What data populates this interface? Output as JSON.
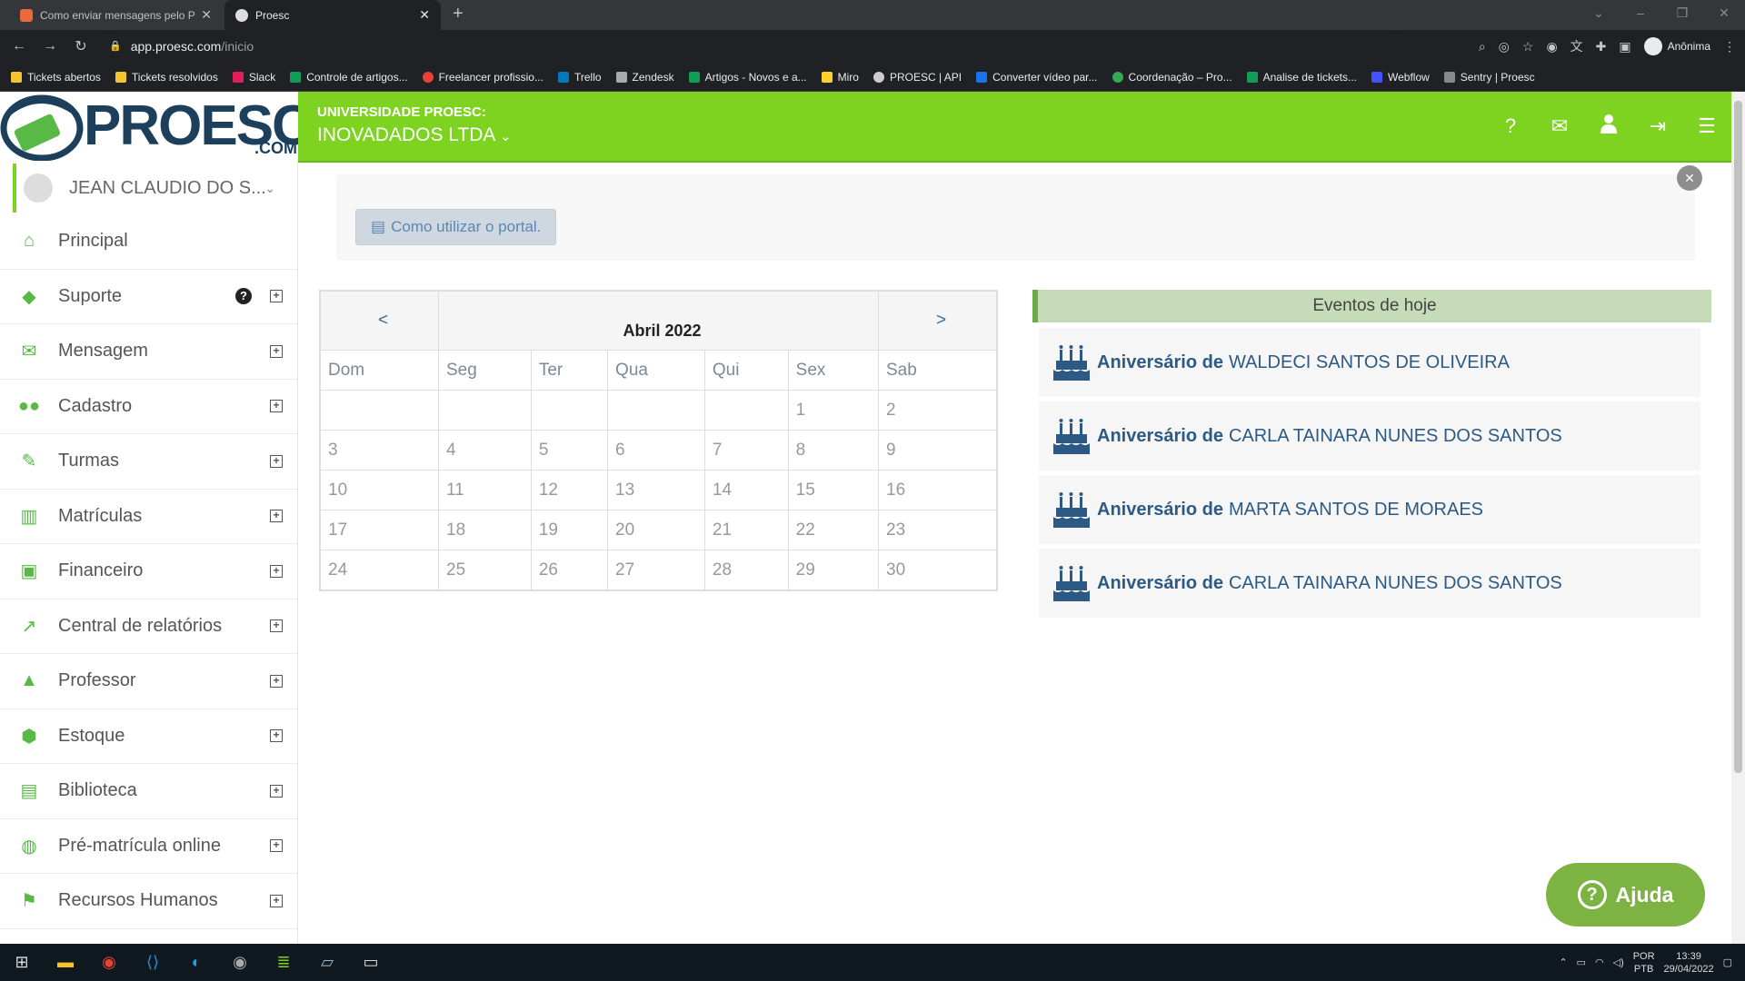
{
  "browser": {
    "tabs": [
      {
        "title": "Como enviar mensagens pelo Pr",
        "active": false
      },
      {
        "title": "Proesc",
        "active": true
      }
    ],
    "url_host": "app.proesc.com",
    "url_path": "/inicio",
    "profile_label": "Anônima",
    "bookmarks": [
      "Tickets abertos",
      "Tickets resolvidos",
      "Slack",
      "Controle de artigos...",
      "Freelancer profissio...",
      "Trello",
      "Zendesk",
      "Artigos - Novos e a...",
      "Miro",
      "PROESC | API",
      "Converter vídeo par...",
      "Coordenação – Pro...",
      "Analise de tickets...",
      "Webflow",
      "Sentry | Proesc"
    ]
  },
  "header": {
    "logo_text": "PROESC",
    "logo_suffix": ".COM",
    "institution_label": "UNIVERSIDADE PROESC:",
    "company": "INOVADADOS LTDA",
    "icons": [
      "question-icon",
      "envelope-icon",
      "user-icon",
      "logout-icon",
      "hamburger-icon"
    ]
  },
  "sidebar": {
    "user_name": "JEAN CLAUDIO DO S...",
    "items": [
      {
        "label": "Principal",
        "icon": "home-icon",
        "expandable": false
      },
      {
        "label": "Suporte",
        "icon": "tag-icon",
        "expandable": true,
        "help": true
      },
      {
        "label": "Mensagem",
        "icon": "envelope-icon",
        "expandable": true
      },
      {
        "label": "Cadastro",
        "icon": "users-icon",
        "expandable": true
      },
      {
        "label": "Turmas",
        "icon": "pencil-icon",
        "expandable": true
      },
      {
        "label": "Matrículas",
        "icon": "book-icon",
        "expandable": true
      },
      {
        "label": "Financeiro",
        "icon": "money-icon",
        "expandable": true
      },
      {
        "label": "Central de relatórios",
        "icon": "chart-icon",
        "expandable": true
      },
      {
        "label": "Professor",
        "icon": "graduation-cap-icon",
        "expandable": true
      },
      {
        "label": "Estoque",
        "icon": "box-icon",
        "expandable": true
      },
      {
        "label": "Biblioteca",
        "icon": "archive-icon",
        "expandable": true
      },
      {
        "label": "Pré-matrícula online",
        "icon": "globe-icon",
        "expandable": true
      },
      {
        "label": "Recursos Humanos",
        "icon": "flag-icon",
        "expandable": true
      }
    ]
  },
  "main": {
    "portal_button": "Como utilizar o portal.",
    "calendar": {
      "prev": "<",
      "next": ">",
      "month": "Abril 2022",
      "weekdays": [
        "Dom",
        "Seg",
        "Ter",
        "Qua",
        "Qui",
        "Sex",
        "Sab"
      ],
      "weeks": [
        [
          "",
          "",
          "",
          "",
          "",
          "1",
          "2"
        ],
        [
          "3",
          "4",
          "5",
          "6",
          "7",
          "8",
          "9"
        ],
        [
          "10",
          "11",
          "12",
          "13",
          "14",
          "15",
          "16"
        ],
        [
          "17",
          "18",
          "19",
          "20",
          "21",
          "22",
          "23"
        ],
        [
          "24",
          "25",
          "26",
          "27",
          "28",
          "29",
          "30"
        ]
      ]
    },
    "events": {
      "title": "Eventos de hoje",
      "prefix": "Aniversário de",
      "items": [
        "WALDECI SANTOS DE OLIVEIRA",
        "CARLA TAINARA NUNES DOS SANTOS",
        "MARTA SANTOS DE MORAES",
        "CARLA TAINARA NUNES DOS SANTOS"
      ]
    },
    "help_button": "Ajuda"
  },
  "taskbar": {
    "lang1": "POR",
    "lang2": "PTB",
    "time": "13:39",
    "date": "29/04/2022"
  },
  "colors": {
    "brand_green": "#7ed321",
    "brand_navy": "#1c3f5c",
    "link_blue": "#2c5a85"
  }
}
